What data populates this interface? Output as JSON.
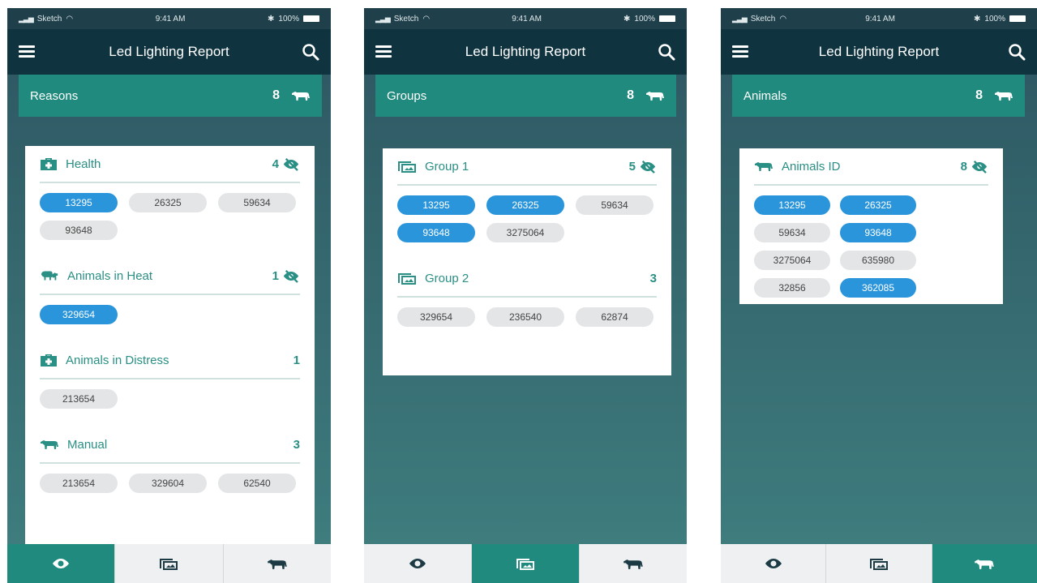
{
  "status_bar": {
    "carrier": "Sketch",
    "time": "9:41 AM",
    "battery": "100%"
  },
  "colors": {
    "accent": "#1f8a7d",
    "appbar": "#0f3440",
    "chip_selected": "#2b95db",
    "chip_default": "#e3e5e6"
  },
  "screens": [
    {
      "app_title": "Led Lighting Report",
      "section": {
        "label": "Reasons",
        "count": "8",
        "icon": "cow-icon"
      },
      "groups": [
        {
          "title": "Health",
          "icon": "medical-kit-icon",
          "count": "4",
          "hidden_toggle": true,
          "chips": [
            {
              "id": "13295",
              "selected": true
            },
            {
              "id": "26325",
              "selected": false
            },
            {
              "id": "59634",
              "selected": false
            },
            {
              "id": "93648",
              "selected": false
            }
          ]
        },
        {
          "title": "Animals in Heat",
          "icon": "animals-in-heat-icon",
          "count": "1",
          "hidden_toggle": true,
          "chips": [
            {
              "id": "329654",
              "selected": true
            }
          ]
        },
        {
          "title": "Animals in Distress",
          "icon": "medical-kit-icon",
          "count": "1",
          "hidden_toggle": false,
          "chips": [
            {
              "id": "213654",
              "selected": false
            }
          ]
        },
        {
          "title": "Manual",
          "icon": "cow-icon",
          "count": "3",
          "hidden_toggle": false,
          "chips": [
            {
              "id": "213654",
              "selected": false
            },
            {
              "id": "329604",
              "selected": false
            },
            {
              "id": "62540",
              "selected": false
            }
          ]
        }
      ],
      "active_tab": 0
    },
    {
      "app_title": "Led Lighting Report",
      "section": {
        "label": "Groups",
        "count": "8",
        "icon": "cow-icon"
      },
      "groups": [
        {
          "title": "Group 1",
          "icon": "group-icon",
          "count": "5",
          "hidden_toggle": true,
          "chips": [
            {
              "id": "13295",
              "selected": true
            },
            {
              "id": "26325",
              "selected": true
            },
            {
              "id": "59634",
              "selected": false
            },
            {
              "id": "93648",
              "selected": true
            },
            {
              "id": "3275064",
              "selected": false
            }
          ]
        },
        {
          "title": "Group 2",
          "icon": "group-icon",
          "count": "3",
          "hidden_toggle": false,
          "chips": [
            {
              "id": "329654",
              "selected": false
            },
            {
              "id": "236540",
              "selected": false
            },
            {
              "id": "62874",
              "selected": false
            }
          ]
        }
      ],
      "active_tab": 1
    },
    {
      "app_title": "Led Lighting Report",
      "section": {
        "label": "Animals",
        "count": "8",
        "icon": "cow-icon"
      },
      "groups": [
        {
          "title": "Animals ID",
          "icon": "cow-icon",
          "count": "8",
          "hidden_toggle": true,
          "chips": [
            {
              "id": "13295",
              "selected": true
            },
            {
              "id": "26325",
              "selected": true
            },
            {
              "id": "59634",
              "selected": false
            },
            {
              "id": "93648",
              "selected": true
            },
            {
              "id": "3275064",
              "selected": false
            },
            {
              "id": "635980",
              "selected": false
            },
            {
              "id": "32856",
              "selected": false
            },
            {
              "id": "362085",
              "selected": true
            }
          ]
        }
      ],
      "active_tab": 2
    }
  ],
  "tabs": [
    {
      "icon": "eye-icon"
    },
    {
      "icon": "group-icon"
    },
    {
      "icon": "cow-icon"
    }
  ]
}
